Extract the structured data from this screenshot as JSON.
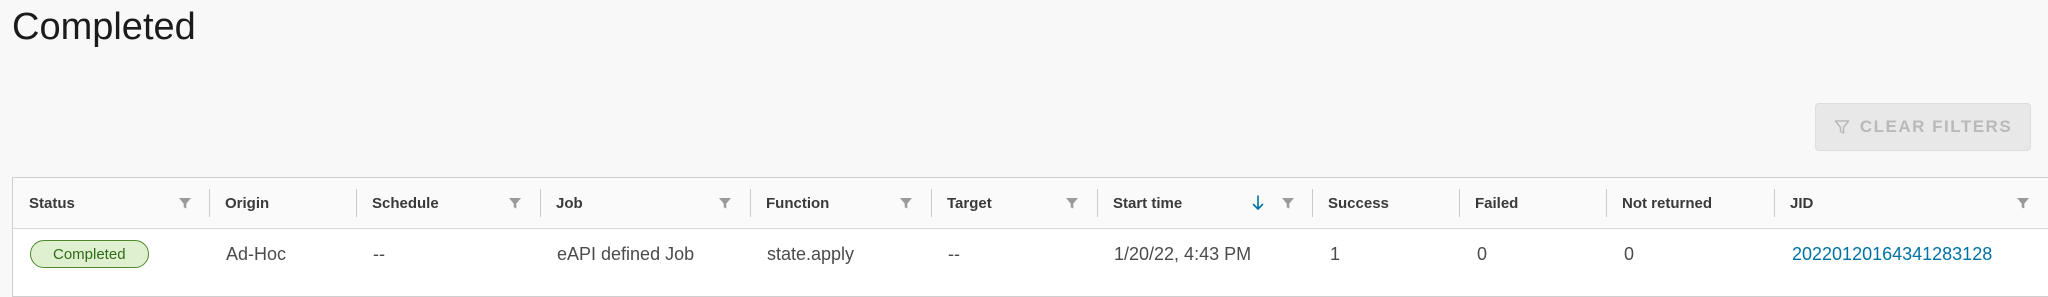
{
  "page": {
    "title": "Completed"
  },
  "toolbar": {
    "clear_filters_label": "CLEAR FILTERS"
  },
  "table": {
    "columns": [
      "Status",
      "Origin",
      "Schedule",
      "Job",
      "Function",
      "Target",
      "Start time",
      "Success",
      "Failed",
      "Not returned",
      "JID"
    ],
    "sorted_column": "Start time",
    "sort_direction": "descending",
    "rows": [
      {
        "status": "Completed",
        "origin": "Ad-Hoc",
        "schedule": "--",
        "job": "eAPI defined Job",
        "function": "state.apply",
        "target": "--",
        "start_time": "1/20/22, 4:43 PM",
        "success": "1",
        "failed": "0",
        "not_returned": "0",
        "jid": "20220120164341283128"
      }
    ]
  },
  "colors": {
    "link": "#0072a3",
    "status_success_bg": "#dff0d0",
    "status_success_border": "#4e8a2c"
  }
}
